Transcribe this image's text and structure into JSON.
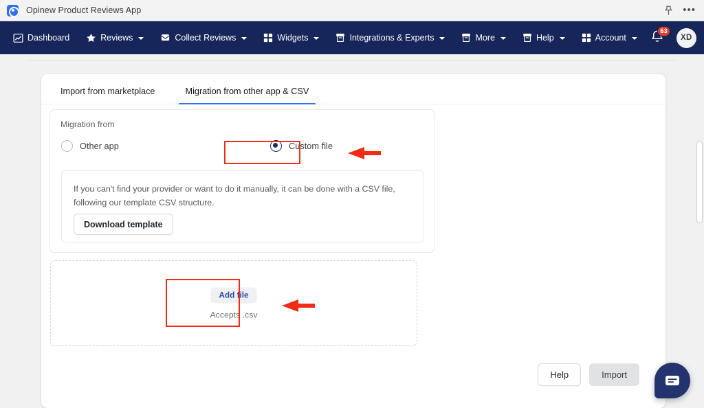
{
  "window": {
    "app_title": "Opinew Product Reviews App",
    "logo_icon": "opinew-logo-icon",
    "pin_icon": "pin-icon",
    "more_icon": "ellipsis-icon"
  },
  "navbar": {
    "background_color": "#17265a",
    "items": [
      {
        "label": "Dashboard",
        "icon": "chart-icon",
        "caret": false
      },
      {
        "label": "Reviews",
        "icon": "star-icon",
        "caret": true
      },
      {
        "label": "Collect Reviews",
        "icon": "envelope-icon",
        "caret": true
      },
      {
        "label": "Widgets",
        "icon": "grid-icon",
        "caret": true
      },
      {
        "label": "Integrations & Experts",
        "icon": "archive-icon",
        "caret": true
      },
      {
        "label": "More",
        "icon": "archive-icon",
        "caret": true
      },
      {
        "label": "Help",
        "icon": "archive-icon",
        "caret": true
      },
      {
        "label": "Account",
        "icon": "grid-icon",
        "caret": true
      }
    ],
    "notifications": {
      "icon": "bell-icon",
      "badge_count": "63",
      "badge_color": "#e8392c"
    },
    "avatar": {
      "initials": "XD"
    }
  },
  "main": {
    "tabs": [
      {
        "label": "Import from marketplace",
        "active": false
      },
      {
        "label": "Migration from other app & CSV",
        "active": true
      }
    ],
    "active_tab_underline_color": "#3371f2",
    "migration": {
      "section_label": "Migration from",
      "options": [
        {
          "label": "Other app",
          "selected": false
        },
        {
          "label": "Custom file",
          "selected": true
        }
      ],
      "info": {
        "text": "If you can't find your provider or want to do it manually, it can be done with a CSV file, following our template CSV structure.",
        "download_button": "Download template"
      }
    },
    "dropzone": {
      "add_file_button": "Add file",
      "hint": "Accepts .csv"
    },
    "footer": {
      "help_button": "Help",
      "import_button": "Import"
    }
  },
  "annotations": {
    "highlight_color": "#f42b14",
    "arrow_color": "#f42b14",
    "highlights": [
      "custom-file-radio",
      "add-file-button"
    ],
    "arrows": [
      "arrow-to-custom-file",
      "arrow-to-add-file"
    ]
  },
  "chat_widget": {
    "icon": "chat-bubble-icon",
    "color": "#22336e"
  },
  "scrollbar": {
    "orientation": "vertical"
  }
}
